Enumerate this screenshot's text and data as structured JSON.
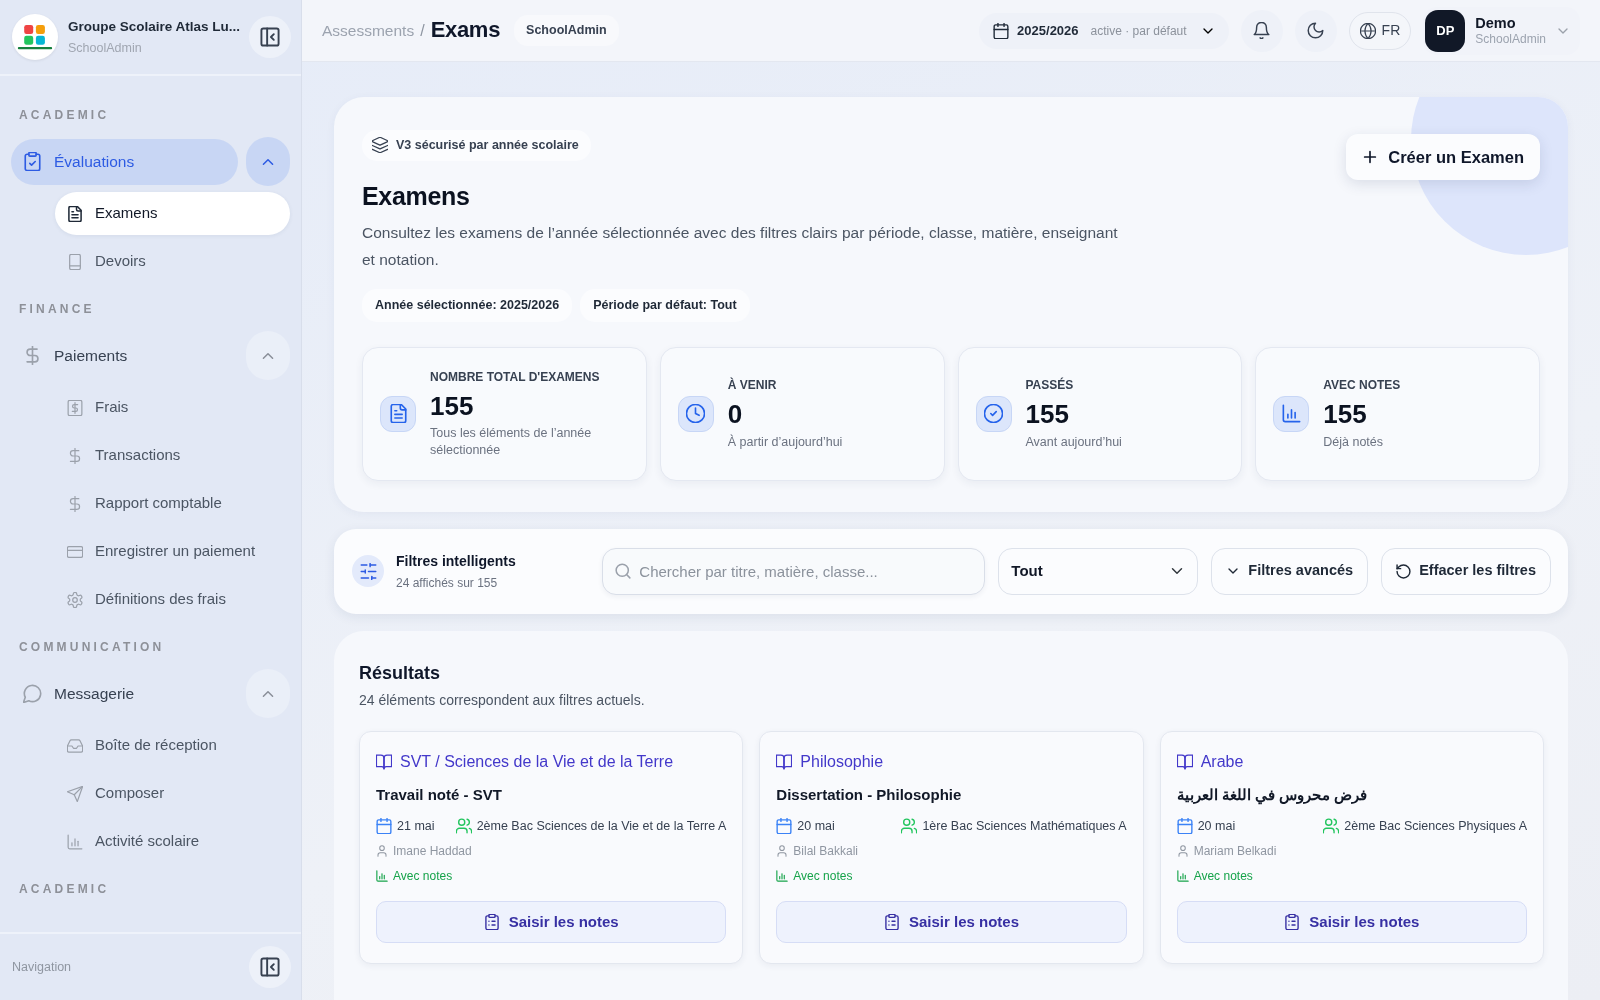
{
  "sidebar": {
    "brand": {
      "name": "Groupe Scolaire Atlas Lu...",
      "subtitle": "SchoolAdmin"
    },
    "sections": [
      {
        "label": "ACADEMIC",
        "items": [
          {
            "label": "Évaluations",
            "selected": true,
            "expanded": true,
            "children": [
              {
                "label": "Examens",
                "selected": true
              },
              {
                "label": "Devoirs",
                "selected": false
              }
            ]
          }
        ]
      },
      {
        "label": "FINANCE",
        "items": [
          {
            "label": "Paiements",
            "selected": false,
            "expanded": true,
            "children": [
              {
                "label": "Frais",
                "selected": false
              },
              {
                "label": "Transactions",
                "selected": false
              },
              {
                "label": "Rapport comptable",
                "selected": false
              },
              {
                "label": "Enregistrer un paiement",
                "selected": false
              },
              {
                "label": "Définitions des frais",
                "selected": false
              }
            ]
          }
        ]
      },
      {
        "label": "COMMUNICATION",
        "items": [
          {
            "label": "Messagerie",
            "selected": false,
            "expanded": true,
            "children": [
              {
                "label": "Boîte de réception",
                "selected": false
              },
              {
                "label": "Composer",
                "selected": false
              },
              {
                "label": "Activité scolaire",
                "selected": false
              }
            ]
          }
        ]
      },
      {
        "label": "ACADEMIC"
      }
    ],
    "footer_label": "Navigation"
  },
  "top_bar": {
    "breadcrumb": {
      "parent": "Assessments",
      "separator": "/",
      "current": "Exams"
    },
    "role_tag": "SchoolAdmin",
    "year_selector": {
      "year": "2025/2026",
      "status": "active · par défaut"
    },
    "language": "FR",
    "user": {
      "initials": "DP",
      "name": "Demo",
      "role": "SchoolAdmin"
    }
  },
  "header": {
    "badge": "V3 sécurisé par année scolaire",
    "title": "Examens",
    "description": "Consultez les examens de l’année sélectionnée avec des filtres clairs par période, classe, matière, enseignant et notation.",
    "chips": [
      "Année sélectionnée: 2025/2026",
      "Période par défaut: Tout"
    ],
    "create_button": "Créer un Examen",
    "stats": [
      {
        "label": "NOMBRE TOTAL D'EXAMENS",
        "value": "155",
        "caption": "Tous les éléments de l’année sélectionnée"
      },
      {
        "label": "À VENIR",
        "value": "0",
        "caption": "À partir d’aujourd’hui"
      },
      {
        "label": "PASSÉS",
        "value": "155",
        "caption": "Avant aujourd’hui"
      },
      {
        "label": "AVEC NOTES",
        "value": "155",
        "caption": "Déjà notés"
      }
    ]
  },
  "filters": {
    "title": "Filtres intelligents",
    "count": "24 affichés sur 155",
    "search": {
      "placeholder": "Chercher par titre, matière, classe..."
    },
    "period_select": {
      "value": "Tout"
    },
    "advanced_button": "Filtres avancés",
    "clear_button": "Effacer les filtres"
  },
  "results": {
    "title": "Résultats",
    "subtitle": "24 éléments correspondent aux filtres actuels.",
    "exams": [
      {
        "subject": "SVT / Sciences de la Vie et de la Terre",
        "title": "Travail noté - SVT",
        "date": "21 mai",
        "class": "2ème Bac Sciences de la Vie et de la Terre A",
        "teacher": "Imane Haddad",
        "grading_status": "Avec notes",
        "action": "Saisir les notes"
      },
      {
        "subject": "Philosophie",
        "title": "Dissertation - Philosophie",
        "date": "20 mai",
        "class": "1ère Bac Sciences Mathématiques A",
        "teacher": "Bilal Bakkali",
        "grading_status": "Avec notes",
        "action": "Saisir les notes"
      },
      {
        "subject": "Arabe",
        "title": "فرض محروس في اللغة العربية",
        "date": "20 mai",
        "class": "2ème Bac Sciences Physiques A",
        "teacher": "Mariam Belkadi",
        "grading_status": "Avec notes",
        "action": "Saisir les notes"
      }
    ]
  }
}
